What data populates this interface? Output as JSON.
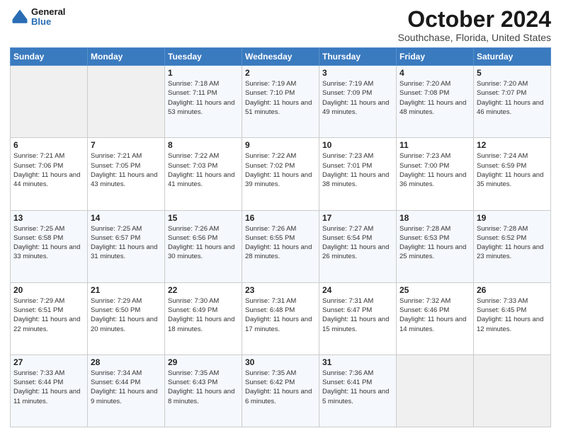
{
  "header": {
    "logo_general": "General",
    "logo_blue": "Blue",
    "title": "October 2024",
    "subtitle": "Southchase, Florida, United States"
  },
  "days_of_week": [
    "Sunday",
    "Monday",
    "Tuesday",
    "Wednesday",
    "Thursday",
    "Friday",
    "Saturday"
  ],
  "weeks": [
    [
      {
        "day": "",
        "info": ""
      },
      {
        "day": "",
        "info": ""
      },
      {
        "day": "1",
        "info": "Sunrise: 7:18 AM\nSunset: 7:11 PM\nDaylight: 11 hours and 53 minutes."
      },
      {
        "day": "2",
        "info": "Sunrise: 7:19 AM\nSunset: 7:10 PM\nDaylight: 11 hours and 51 minutes."
      },
      {
        "day": "3",
        "info": "Sunrise: 7:19 AM\nSunset: 7:09 PM\nDaylight: 11 hours and 49 minutes."
      },
      {
        "day": "4",
        "info": "Sunrise: 7:20 AM\nSunset: 7:08 PM\nDaylight: 11 hours and 48 minutes."
      },
      {
        "day": "5",
        "info": "Sunrise: 7:20 AM\nSunset: 7:07 PM\nDaylight: 11 hours and 46 minutes."
      }
    ],
    [
      {
        "day": "6",
        "info": "Sunrise: 7:21 AM\nSunset: 7:06 PM\nDaylight: 11 hours and 44 minutes."
      },
      {
        "day": "7",
        "info": "Sunrise: 7:21 AM\nSunset: 7:05 PM\nDaylight: 11 hours and 43 minutes."
      },
      {
        "day": "8",
        "info": "Sunrise: 7:22 AM\nSunset: 7:03 PM\nDaylight: 11 hours and 41 minutes."
      },
      {
        "day": "9",
        "info": "Sunrise: 7:22 AM\nSunset: 7:02 PM\nDaylight: 11 hours and 39 minutes."
      },
      {
        "day": "10",
        "info": "Sunrise: 7:23 AM\nSunset: 7:01 PM\nDaylight: 11 hours and 38 minutes."
      },
      {
        "day": "11",
        "info": "Sunrise: 7:23 AM\nSunset: 7:00 PM\nDaylight: 11 hours and 36 minutes."
      },
      {
        "day": "12",
        "info": "Sunrise: 7:24 AM\nSunset: 6:59 PM\nDaylight: 11 hours and 35 minutes."
      }
    ],
    [
      {
        "day": "13",
        "info": "Sunrise: 7:25 AM\nSunset: 6:58 PM\nDaylight: 11 hours and 33 minutes."
      },
      {
        "day": "14",
        "info": "Sunrise: 7:25 AM\nSunset: 6:57 PM\nDaylight: 11 hours and 31 minutes."
      },
      {
        "day": "15",
        "info": "Sunrise: 7:26 AM\nSunset: 6:56 PM\nDaylight: 11 hours and 30 minutes."
      },
      {
        "day": "16",
        "info": "Sunrise: 7:26 AM\nSunset: 6:55 PM\nDaylight: 11 hours and 28 minutes."
      },
      {
        "day": "17",
        "info": "Sunrise: 7:27 AM\nSunset: 6:54 PM\nDaylight: 11 hours and 26 minutes."
      },
      {
        "day": "18",
        "info": "Sunrise: 7:28 AM\nSunset: 6:53 PM\nDaylight: 11 hours and 25 minutes."
      },
      {
        "day": "19",
        "info": "Sunrise: 7:28 AM\nSunset: 6:52 PM\nDaylight: 11 hours and 23 minutes."
      }
    ],
    [
      {
        "day": "20",
        "info": "Sunrise: 7:29 AM\nSunset: 6:51 PM\nDaylight: 11 hours and 22 minutes."
      },
      {
        "day": "21",
        "info": "Sunrise: 7:29 AM\nSunset: 6:50 PM\nDaylight: 11 hours and 20 minutes."
      },
      {
        "day": "22",
        "info": "Sunrise: 7:30 AM\nSunset: 6:49 PM\nDaylight: 11 hours and 18 minutes."
      },
      {
        "day": "23",
        "info": "Sunrise: 7:31 AM\nSunset: 6:48 PM\nDaylight: 11 hours and 17 minutes."
      },
      {
        "day": "24",
        "info": "Sunrise: 7:31 AM\nSunset: 6:47 PM\nDaylight: 11 hours and 15 minutes."
      },
      {
        "day": "25",
        "info": "Sunrise: 7:32 AM\nSunset: 6:46 PM\nDaylight: 11 hours and 14 minutes."
      },
      {
        "day": "26",
        "info": "Sunrise: 7:33 AM\nSunset: 6:45 PM\nDaylight: 11 hours and 12 minutes."
      }
    ],
    [
      {
        "day": "27",
        "info": "Sunrise: 7:33 AM\nSunset: 6:44 PM\nDaylight: 11 hours and 11 minutes."
      },
      {
        "day": "28",
        "info": "Sunrise: 7:34 AM\nSunset: 6:44 PM\nDaylight: 11 hours and 9 minutes."
      },
      {
        "day": "29",
        "info": "Sunrise: 7:35 AM\nSunset: 6:43 PM\nDaylight: 11 hours and 8 minutes."
      },
      {
        "day": "30",
        "info": "Sunrise: 7:35 AM\nSunset: 6:42 PM\nDaylight: 11 hours and 6 minutes."
      },
      {
        "day": "31",
        "info": "Sunrise: 7:36 AM\nSunset: 6:41 PM\nDaylight: 11 hours and 5 minutes."
      },
      {
        "day": "",
        "info": ""
      },
      {
        "day": "",
        "info": ""
      }
    ]
  ]
}
